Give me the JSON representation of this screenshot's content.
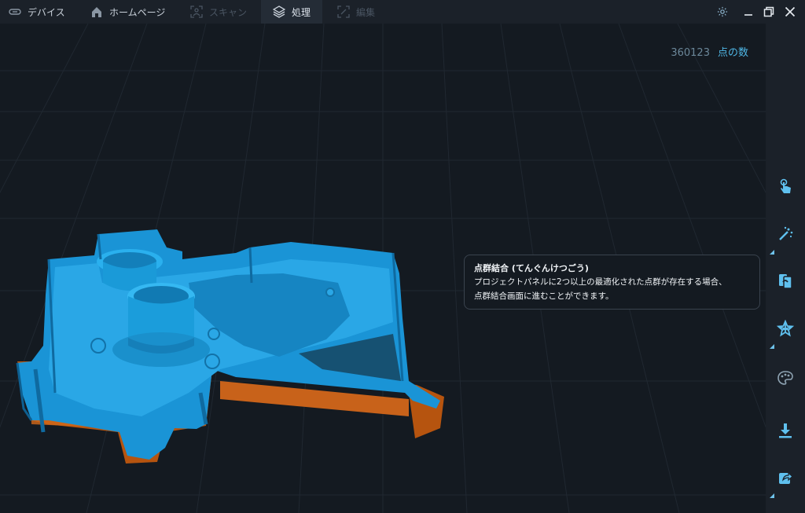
{
  "tabs": {
    "device": {
      "label": "デバイス",
      "icon": "link-icon"
    },
    "home": {
      "label": "ホームページ",
      "icon": "home-icon"
    },
    "scan": {
      "label": "スキャン",
      "icon": "scan-icon"
    },
    "process": {
      "label": "処理",
      "icon": "layers-icon"
    },
    "edit": {
      "label": "編集",
      "icon": "edit-icon"
    }
  },
  "window_controls": [
    "settings-icon",
    "minimize-icon",
    "restore-icon",
    "close-icon"
  ],
  "viewport": {
    "point_count_value": "360123",
    "point_count_label": "点の数"
  },
  "tooltip": {
    "title": "点群結合 (てんぐんけつごう)",
    "line1": "プロジェクトパネルに2つ以上の最適化された点群が存在する場合、",
    "line2": "点群結合画面に進むことができます。"
  },
  "tools": [
    "touch-icon",
    "magic-wand-icon",
    "merge-icon",
    "mesh-star-icon",
    "palette-icon",
    "download-icon",
    "share-icon"
  ],
  "colors": {
    "accent": "#4fb7e6",
    "background": "#141a21",
    "panel": "#1b2129",
    "model_blue": "#1a9ad8",
    "model_orange": "#c45a12"
  }
}
